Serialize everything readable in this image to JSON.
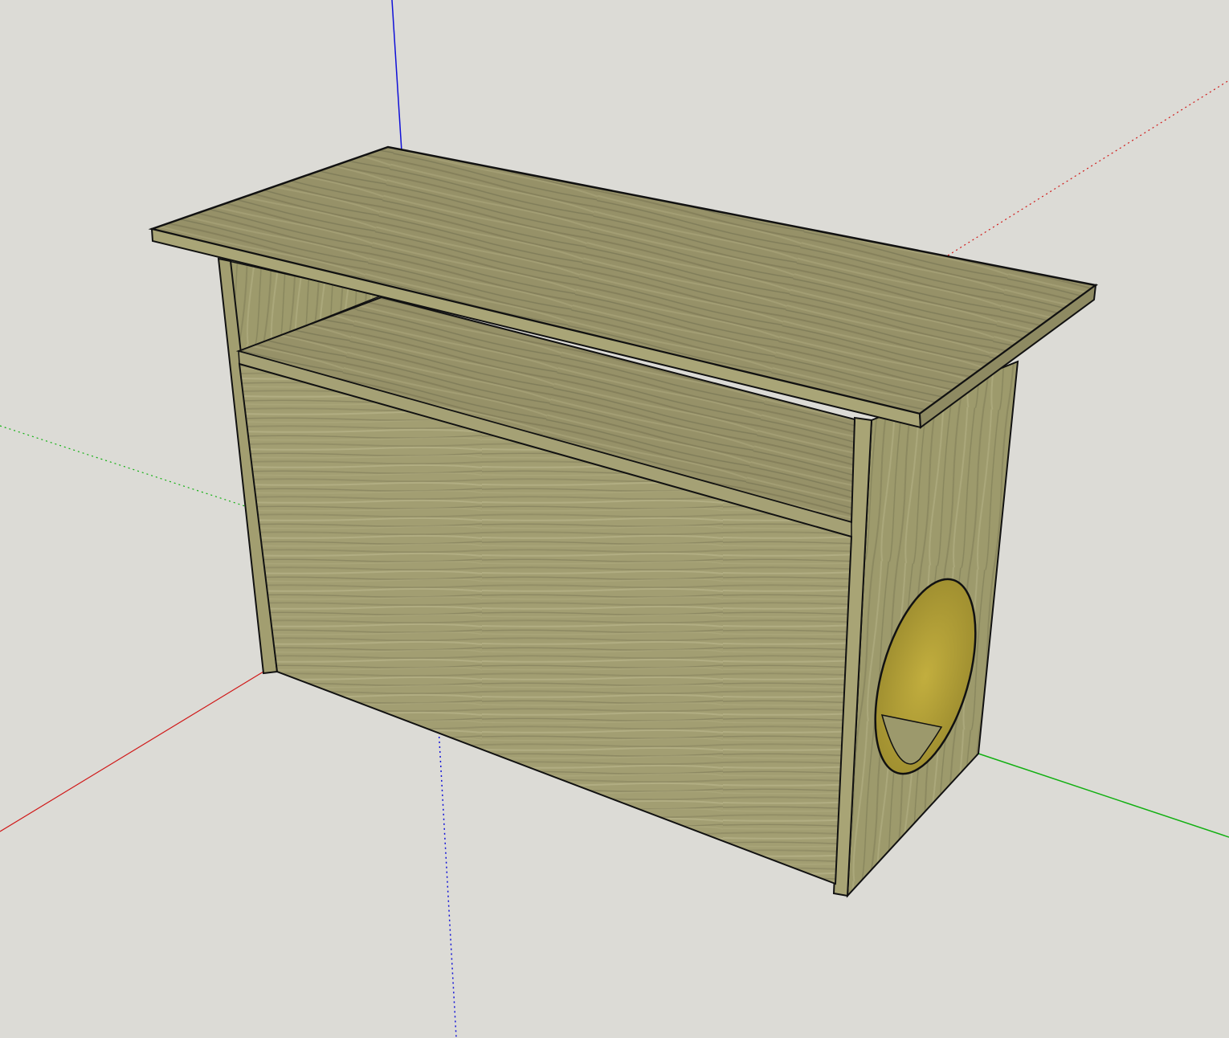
{
  "viewport": {
    "background": "#dcdbd6",
    "axes": {
      "red_axis_color": "#d01818",
      "green_axis_color": "#12b012",
      "blue_axis_color": "#1010d8"
    }
  },
  "model": {
    "name": "",
    "material": "wood-grain",
    "colors": {
      "wood_light": "#a9a577",
      "wood_mid": "#8f8a63",
      "wood_dark": "#6e6a4a",
      "edge_stroke": "#111111",
      "hole_inside": "#b5a23a"
    }
  }
}
